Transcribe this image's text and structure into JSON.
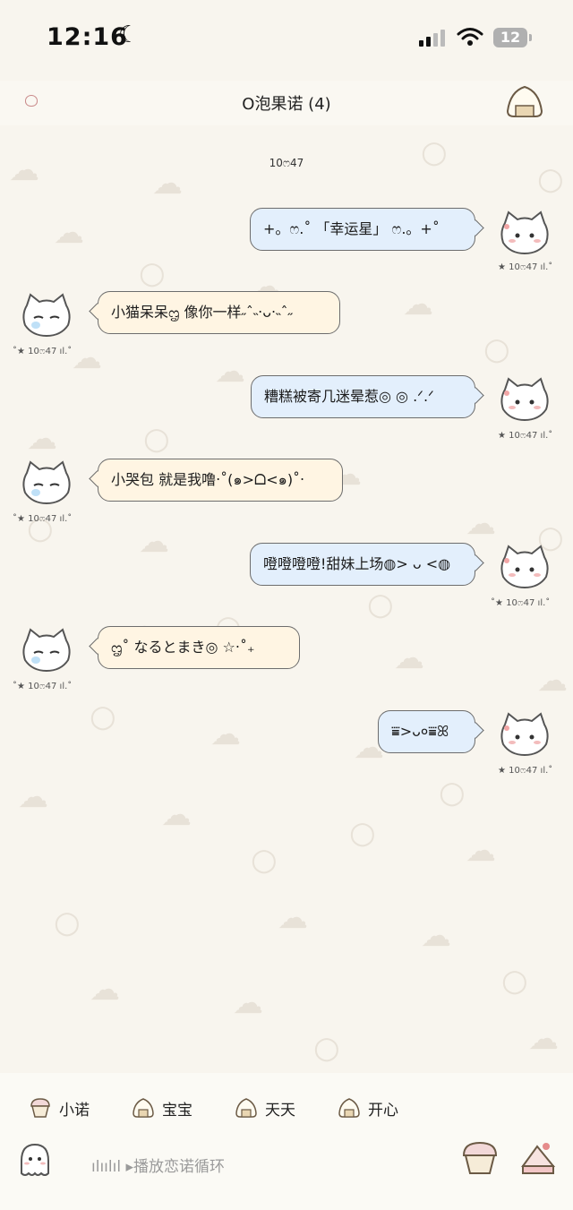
{
  "status_bar": {
    "time": "12:16",
    "battery": "12"
  },
  "header": {
    "title": "O泡果诺 (4)"
  },
  "timestamp_divider": "10ෆ47",
  "messages": [
    {
      "direction": "out",
      "text": "+。ෆ.˚ 「幸运星」 ෆ.。+˚",
      "time": "★ 10ෆ47 ıl.˚"
    },
    {
      "direction": "in",
      "text": "小猫呆呆ᦗ 像你一样˶ˆ˵‧ᴗ‧˵ˆ˶",
      "time": "˚★ 10ෆ47 ıl.˚"
    },
    {
      "direction": "out",
      "text": "糟糕被寄几迷晕惹◎ ◎ .ᐟ.ᐟ",
      "time": "★ 10ෆ47 ıl.˚"
    },
    {
      "direction": "in",
      "text": "小哭包 就是我噜‧˚(๑>ᗝ<๑)˚‧",
      "time": "˚★ 10ෆ47 ıl.˚"
    },
    {
      "direction": "out",
      "text": "噔噔噔噔!甜妹上场◍> ᴗ <◍",
      "time": "˚★ 10ෆ47 ıl.˚"
    },
    {
      "direction": "in",
      "text": "ᦗ˚ なるとまき◎ ☆‧˚₊",
      "time": "˚★ 10ෆ47 ıl.˚"
    },
    {
      "direction": "out",
      "text": "⩸>ᴗ०⩸ꕤ",
      "time": "★ 10ෆ47 ıl.˚"
    }
  ],
  "quick_replies": [
    {
      "label": "小诺",
      "icon": "cupcake-icon"
    },
    {
      "label": "宝宝",
      "icon": "onigiri-icon"
    },
    {
      "label": "天天",
      "icon": "onigiri-icon"
    },
    {
      "label": "开心",
      "icon": "onigiri-icon"
    }
  ],
  "input_bar": {
    "music_text": "ılıılıl ▸播放恋诺循环"
  },
  "colors": {
    "incoming_bubble": "#fff5e3",
    "outgoing_bubble": "#e3effc",
    "bubble_border": "#6d6d6d",
    "background": "#f8f5ee"
  }
}
